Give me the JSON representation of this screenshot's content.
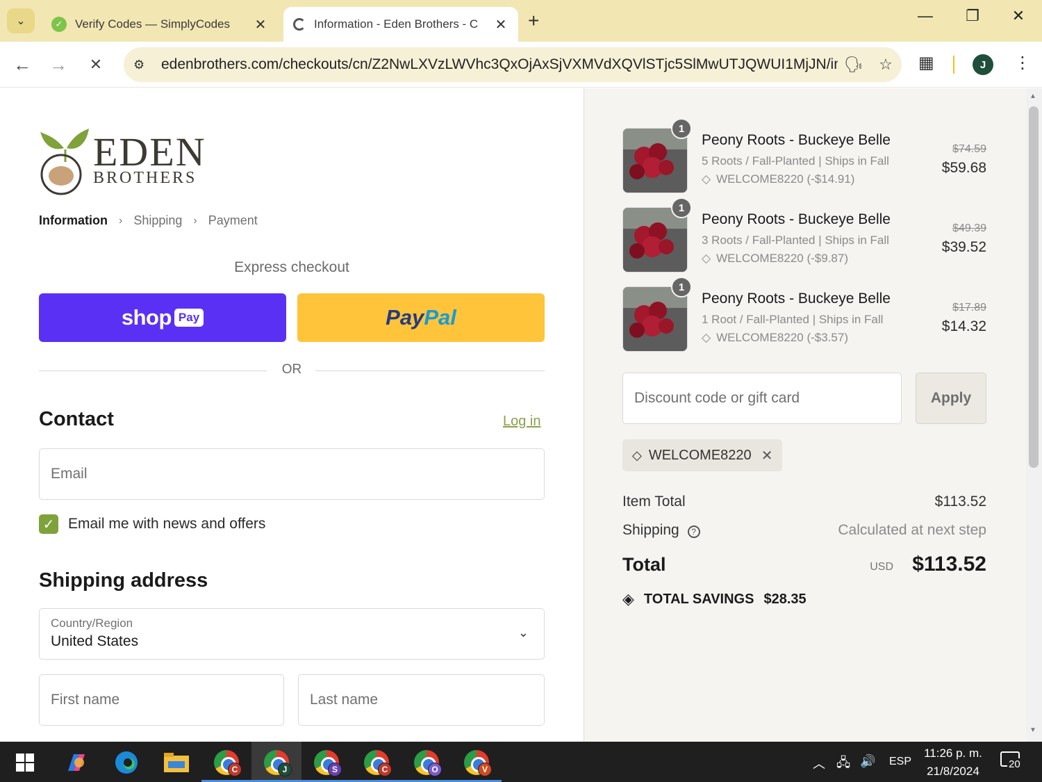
{
  "browser": {
    "tabs": [
      {
        "title": "Verify Codes — SimplyCodes",
        "active": false
      },
      {
        "title": "Information - Eden Brothers - C",
        "active": true
      }
    ],
    "url": "edenbrothers.com/checkouts/cn/Z2NwLXVzLWVhc3QxOjAxSjVXMVdXQVlSTjc5SlMwUTJQWUI1MjJN/inf...",
    "profile_initial": "J",
    "icons": {
      "tab_search": "chevron-down-icon",
      "new_tab": "+",
      "minimize": "—",
      "restore": "❐",
      "close": "✕"
    }
  },
  "logo": {
    "line1": "EDEN",
    "line2": "BROTHERS"
  },
  "breadcrumbs": {
    "step1": "Information",
    "step2": "Shipping",
    "step3": "Payment",
    "sep": "›"
  },
  "express": {
    "heading": "Express checkout",
    "shop_word": "shop",
    "shop_pay": "Pay",
    "paypal_1": "Pay",
    "paypal_2": "Pal"
  },
  "divider_text": "OR",
  "contact": {
    "heading": "Contact",
    "login_link": "Log in",
    "email_placeholder": "Email",
    "newsletter_label": "Email me with news and offers",
    "newsletter_checked": true
  },
  "shipping_address": {
    "heading": "Shipping address",
    "country_label": "Country/Region",
    "country_value": "United States",
    "first_name_placeholder": "First name",
    "last_name_placeholder": "Last name"
  },
  "order": {
    "items": [
      {
        "qty": "1",
        "name": "Peony Roots - Buckeye Belle",
        "variant": "5 Roots / Fall-Planted | Ships in Fall",
        "discount": "WELCOME8220 (-$14.91)",
        "original": "$74.59",
        "price": "$59.68"
      },
      {
        "qty": "1",
        "name": "Peony Roots - Buckeye Belle",
        "variant": "3 Roots / Fall-Planted | Ships in Fall",
        "discount": "WELCOME8220 (-$9.87)",
        "original": "$49.39",
        "price": "$39.52"
      },
      {
        "qty": "1",
        "name": "Peony Roots - Buckeye Belle",
        "variant": "1 Root / Fall-Planted | Ships in Fall",
        "discount": "WELCOME8220 (-$3.57)",
        "original": "$17.89",
        "price": "$14.32"
      }
    ],
    "discount_placeholder": "Discount code or gift card",
    "apply_label": "Apply",
    "applied_code": "WELCOME8220",
    "item_total_label": "Item Total",
    "item_total_value": "$113.52",
    "shipping_label": "Shipping",
    "shipping_value": "Calculated at next step",
    "total_label": "Total",
    "currency": "USD",
    "total_value": "$113.52",
    "savings_label": "TOTAL SAVINGS",
    "savings_value": "$28.35"
  },
  "taskbar": {
    "apps": [
      {
        "badge": "C",
        "badge_color": "#c0392b",
        "active": false
      },
      {
        "badge": "J",
        "badge_color": "#1f4f3a",
        "active": true
      },
      {
        "badge": "S",
        "badge_color": "#6a3fb5",
        "active": false
      },
      {
        "badge": "C",
        "badge_color": "#c0392b",
        "active": false
      },
      {
        "badge": "O",
        "badge_color": "#7d5bd0",
        "active": false
      },
      {
        "badge": "V",
        "badge_color": "#d04a1e",
        "active": false
      }
    ],
    "language": "ESP",
    "time": "11:26 p. m.",
    "date": "21/8/2024",
    "notifications": "20"
  },
  "colors": {
    "tabbar": "#f2e6b3",
    "shop_pay": "#5a31f4",
    "paypal": "#ffc439",
    "accent_green": "#7fa23a",
    "summary_bg": "#f5f4f1"
  }
}
